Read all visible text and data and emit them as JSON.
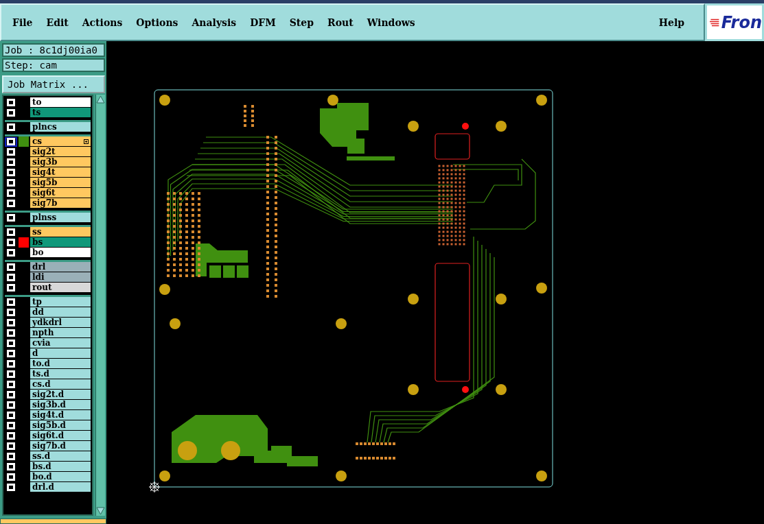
{
  "menu": [
    {
      "label": "File"
    },
    {
      "label": "Edit"
    },
    {
      "label": "Actions"
    },
    {
      "label": "Options"
    },
    {
      "label": "Analysis"
    },
    {
      "label": "DFM"
    },
    {
      "label": "Step"
    },
    {
      "label": "Rout"
    },
    {
      "label": "Windows"
    }
  ],
  "help": "Help",
  "logo": "Fron",
  "job": "Job : 8c1dj00ia0",
  "step": "Step: cam",
  "job_matrix_button": "Job Matrix ...",
  "layer_groups": [
    [
      {
        "name": "to",
        "kind": "silk",
        "selected": false,
        "checked": false
      },
      {
        "name": "ts",
        "kind": "mask",
        "selected": false,
        "checked": false
      }
    ],
    [
      {
        "name": "plncs",
        "kind": "doc",
        "selected": false,
        "checked": false
      }
    ],
    [
      {
        "name": "cs",
        "kind": "signal",
        "selected": true,
        "checked": false,
        "color": "#409010"
      },
      {
        "name": "sig2t",
        "kind": "signal",
        "selected": false,
        "checked": false
      },
      {
        "name": "sig3b",
        "kind": "signal",
        "selected": false,
        "checked": false
      },
      {
        "name": "sig4t",
        "kind": "signal",
        "selected": false,
        "checked": false
      },
      {
        "name": "sig5b",
        "kind": "signal",
        "selected": false,
        "checked": false
      },
      {
        "name": "sig6t",
        "kind": "signal",
        "selected": false,
        "checked": false
      },
      {
        "name": "sig7b",
        "kind": "signal",
        "selected": false,
        "checked": false
      }
    ],
    [
      {
        "name": "plnss",
        "kind": "doc",
        "selected": false,
        "checked": false
      }
    ],
    [
      {
        "name": "ss",
        "kind": "signal",
        "selected": false,
        "checked": false
      },
      {
        "name": "bs",
        "kind": "mask",
        "selected": false,
        "checked": false,
        "color": "#ff0000"
      },
      {
        "name": "bo",
        "kind": "silk",
        "selected": false,
        "checked": false
      }
    ],
    [
      {
        "name": "drl",
        "kind": "drill",
        "selected": false,
        "checked": false
      },
      {
        "name": "ldi",
        "kind": "drill",
        "selected": false,
        "checked": false
      },
      {
        "name": "rout",
        "kind": "rout",
        "selected": false,
        "checked": false
      }
    ],
    [
      {
        "name": "tp",
        "kind": "doc",
        "selected": false,
        "checked": false
      },
      {
        "name": "dd",
        "kind": "doc",
        "selected": false,
        "checked": false
      },
      {
        "name": "ydkdrl",
        "kind": "doc",
        "selected": false,
        "checked": false
      },
      {
        "name": "npth",
        "kind": "doc",
        "selected": false,
        "checked": false
      },
      {
        "name": "cvia",
        "kind": "doc",
        "selected": false,
        "checked": false
      },
      {
        "name": "d",
        "kind": "doc",
        "selected": false,
        "checked": false
      },
      {
        "name": "to.d",
        "kind": "doc",
        "selected": false,
        "checked": false
      },
      {
        "name": "ts.d",
        "kind": "doc",
        "selected": false,
        "checked": false
      },
      {
        "name": "cs.d",
        "kind": "doc",
        "selected": false,
        "checked": false
      },
      {
        "name": "sig2t.d",
        "kind": "doc",
        "selected": false,
        "checked": false
      },
      {
        "name": "sig3b.d",
        "kind": "doc",
        "selected": false,
        "checked": false
      },
      {
        "name": "sig4t.d",
        "kind": "doc",
        "selected": false,
        "checked": false
      },
      {
        "name": "sig5b.d",
        "kind": "doc",
        "selected": false,
        "checked": false
      },
      {
        "name": "sig6t.d",
        "kind": "doc",
        "selected": false,
        "checked": false
      },
      {
        "name": "sig7b.d",
        "kind": "doc",
        "selected": false,
        "checked": false
      },
      {
        "name": "ss.d",
        "kind": "doc",
        "selected": false,
        "checked": false
      },
      {
        "name": "bs.d",
        "kind": "doc",
        "selected": false,
        "checked": false
      },
      {
        "name": "bo.d",
        "kind": "doc",
        "selected": false,
        "checked": false
      },
      {
        "name": "drl.d",
        "kind": "doc",
        "selected": false,
        "checked": false
      }
    ]
  ]
}
